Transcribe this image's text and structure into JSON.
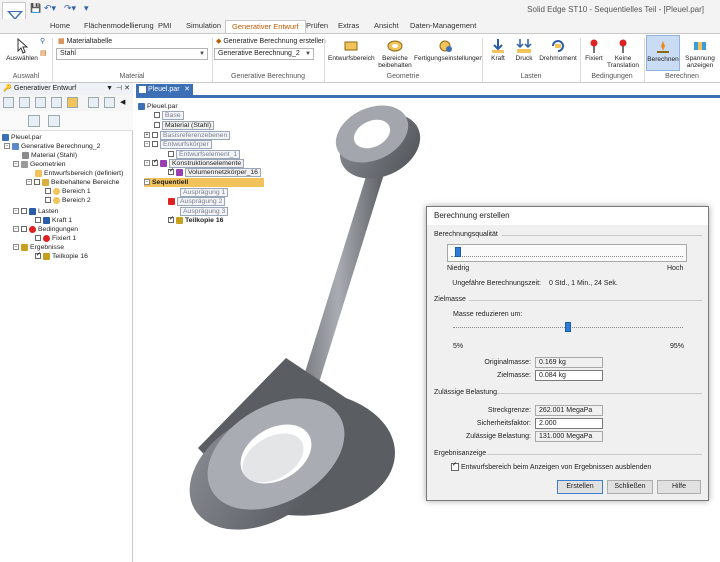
{
  "app": {
    "title": "Solid Edge ST10 - Sequentielles Teil - [Pleuel.par]"
  },
  "ribbon": {
    "tabs": [
      "Home",
      "Flächenmodellierung",
      "PMI",
      "Simulation",
      "Generativer Entwurf",
      "Prüfen",
      "Extras",
      "Ansicht",
      "Daten-Management"
    ],
    "active_tab": "Generativer Entwurf",
    "auswahl": {
      "button": "Auswählen",
      "group": "Auswahl"
    },
    "material": {
      "table_label": "Materialtabelle",
      "value": "Stahl",
      "group": "Material"
    },
    "gen": {
      "create_label": "Generative Berechnung erstellen",
      "value": "Generative Berechnung_2",
      "group": "Generative Berechnung"
    },
    "geometrie": {
      "entwurfsbereich": "Entwurfsbereich",
      "bereiche1": "Bereiche",
      "bereiche2": "beibehalten",
      "fertigung": "Fertigungseinstellungen",
      "group": "Geometrie"
    },
    "lasten": {
      "kraft": "Kraft",
      "druck": "Druck",
      "drehmoment": "Drehmoment",
      "group": "Lasten"
    },
    "bedingungen": {
      "fixiert": "Fixiert",
      "keine1": "Keine",
      "keine2": "Translation",
      "group": "Bedingungen"
    },
    "berechnen": {
      "berechnen": "Berechnen",
      "spannung1": "Spannung",
      "spannung2": "anzeigen",
      "group": "Berechnen"
    }
  },
  "left_panel": {
    "header": "Generativer Entwurf",
    "tree": [
      "Pleuel.par",
      "Generative Berechnung_2",
      "Material (Stahl)",
      "Geometrien",
      "Entwurfsbereich (definiert)",
      "Beibehaltene Bereiche",
      "Bereich 1",
      "Bereich 2",
      "Lasten",
      "Kraft 1",
      "Bedingungen",
      "Fixiert 1",
      "Ergebnisse",
      "Teilkopie 16"
    ]
  },
  "document": {
    "tab": "Pleuel.par",
    "tree": [
      "Pleuel.par",
      "Base",
      "Material (Stahl)",
      "Basisreferenzebenen",
      "Entwurfskörper",
      "Entwurfselement_1",
      "Konstruktionselemente",
      "Volumennetzkörper_16",
      "Sequentiell",
      "Ausprägung 1",
      "Ausprägung 2",
      "Ausprägung 3",
      "Teilkopie 16"
    ]
  },
  "dialog": {
    "title": "Berechnung erstellen",
    "quality_section": "Berechnungsqualität",
    "quality_low": "Niedrig",
    "quality_high": "Hoch",
    "quality_level": 0.02,
    "approx_label": "Ungefähre Berechnungszeit:",
    "approx_value": "0 Std., 1 Min., 24 Sek.",
    "target_section": "Zielmasse",
    "reduce_label": "Masse reduzieren um:",
    "reduce_min": "5%",
    "reduce_max": "95%",
    "reduce_level": 0.5,
    "orig_mass_label": "Originalmasse:",
    "orig_mass_value": "0.169 kg",
    "target_mass_label": "Zielmasse:",
    "target_mass_value": "0.084 kg",
    "load_section": "Zulässige Belastung",
    "yield_label": "Streckgrenze:",
    "yield_value": "262.001 MegaPa",
    "safety_label": "Sicherheitsfaktor:",
    "safety_value": "2.000",
    "allowed_label": "Zulässige Belastung:",
    "allowed_value": "131.000 MegaPa",
    "result_section": "Ergebnisanzeige",
    "hide_checkbox": "Entwurfsbereich beim Anzeigen von Ergebnissen ausblenden",
    "hide_checked": true,
    "btn_create": "Erstellen",
    "btn_close": "Schließen",
    "btn_help": "Hilfe"
  }
}
